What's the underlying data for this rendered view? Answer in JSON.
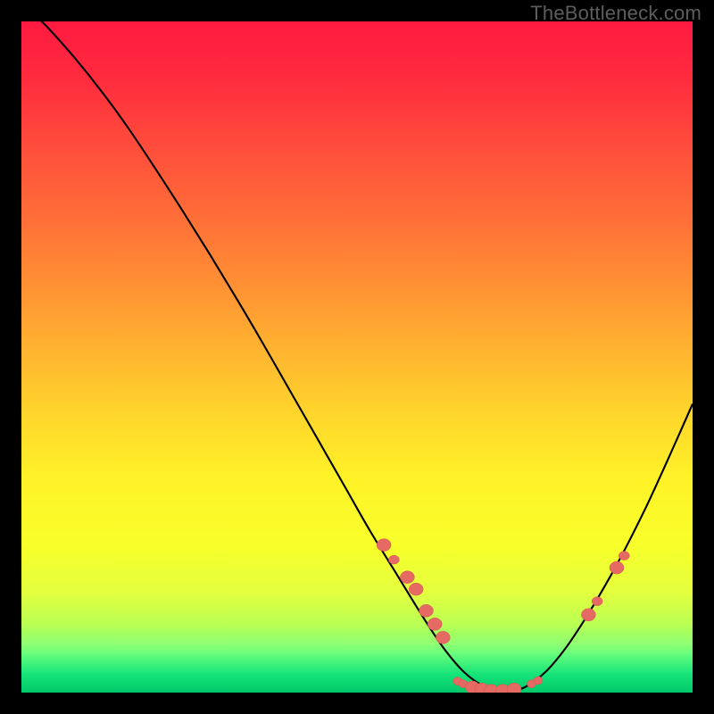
{
  "watermark": "TheBottleneck.com",
  "chart_data": {
    "type": "line",
    "title": "",
    "xlabel": "",
    "ylabel": "",
    "xlim": [
      0,
      100
    ],
    "ylim": [
      0,
      100
    ],
    "grid": false,
    "legend": false,
    "description": "Bottleneck percentage curve descending from high on the left to a minimum near x≈70 then rising, over a red→yellow→green vertical severity gradient (red=high bottleneck, green=low).",
    "series": [
      {
        "name": "bottleneck",
        "x": [
          0,
          4,
          8,
          12,
          16,
          20,
          24,
          28,
          32,
          36,
          40,
          44,
          48,
          52,
          56,
          60,
          63,
          66,
          69,
          72,
          75,
          78,
          81,
          84,
          87,
          90,
          93,
          96,
          100
        ],
        "y": [
          103,
          99,
          94.5,
          89.5,
          84,
          78,
          71.8,
          65.4,
          58.8,
          52,
          45,
          38,
          31,
          24,
          17.5,
          11,
          6.5,
          3,
          0.9,
          0.1,
          0.8,
          3,
          6.5,
          11,
          16,
          21.5,
          27.5,
          34,
          43
        ]
      }
    ],
    "markers": [
      {
        "x": 54,
        "y": 22,
        "size": "big"
      },
      {
        "x": 55.5,
        "y": 19.8,
        "size": "mid"
      },
      {
        "x": 57.5,
        "y": 17.2,
        "size": "big"
      },
      {
        "x": 58.8,
        "y": 15.4,
        "size": "big"
      },
      {
        "x": 60.3,
        "y": 12.2,
        "size": "big"
      },
      {
        "x": 61.6,
        "y": 10.2,
        "size": "big"
      },
      {
        "x": 62.8,
        "y": 8.2,
        "size": "big"
      },
      {
        "x": 65,
        "y": 1.7,
        "size": "sm"
      },
      {
        "x": 65.8,
        "y": 1.3,
        "size": "sm"
      },
      {
        "x": 67.2,
        "y": 0.8,
        "size": "big"
      },
      {
        "x": 68.6,
        "y": 0.5,
        "size": "big"
      },
      {
        "x": 70,
        "y": 0.3,
        "size": "big"
      },
      {
        "x": 71.7,
        "y": 0.3,
        "size": "big"
      },
      {
        "x": 73.4,
        "y": 0.5,
        "size": "big"
      },
      {
        "x": 76,
        "y": 1.3,
        "size": "sm"
      },
      {
        "x": 77,
        "y": 1.8,
        "size": "sm"
      },
      {
        "x": 84.5,
        "y": 11.6,
        "size": "big"
      },
      {
        "x": 85.8,
        "y": 13.6,
        "size": "mid"
      },
      {
        "x": 88.7,
        "y": 18.6,
        "size": "big"
      },
      {
        "x": 89.8,
        "y": 20.4,
        "size": "mid"
      }
    ],
    "gradient_stops": [
      {
        "pct": 0,
        "color": "#ff1a40"
      },
      {
        "pct": 18,
        "color": "#ff4b3c"
      },
      {
        "pct": 38,
        "color": "#ff8c34"
      },
      {
        "pct": 58,
        "color": "#ffd42c"
      },
      {
        "pct": 78,
        "color": "#f8ff2a"
      },
      {
        "pct": 90,
        "color": "#b8ff54"
      },
      {
        "pct": 97,
        "color": "#17e57a"
      },
      {
        "pct": 100,
        "color": "#00c86a"
      }
    ]
  }
}
